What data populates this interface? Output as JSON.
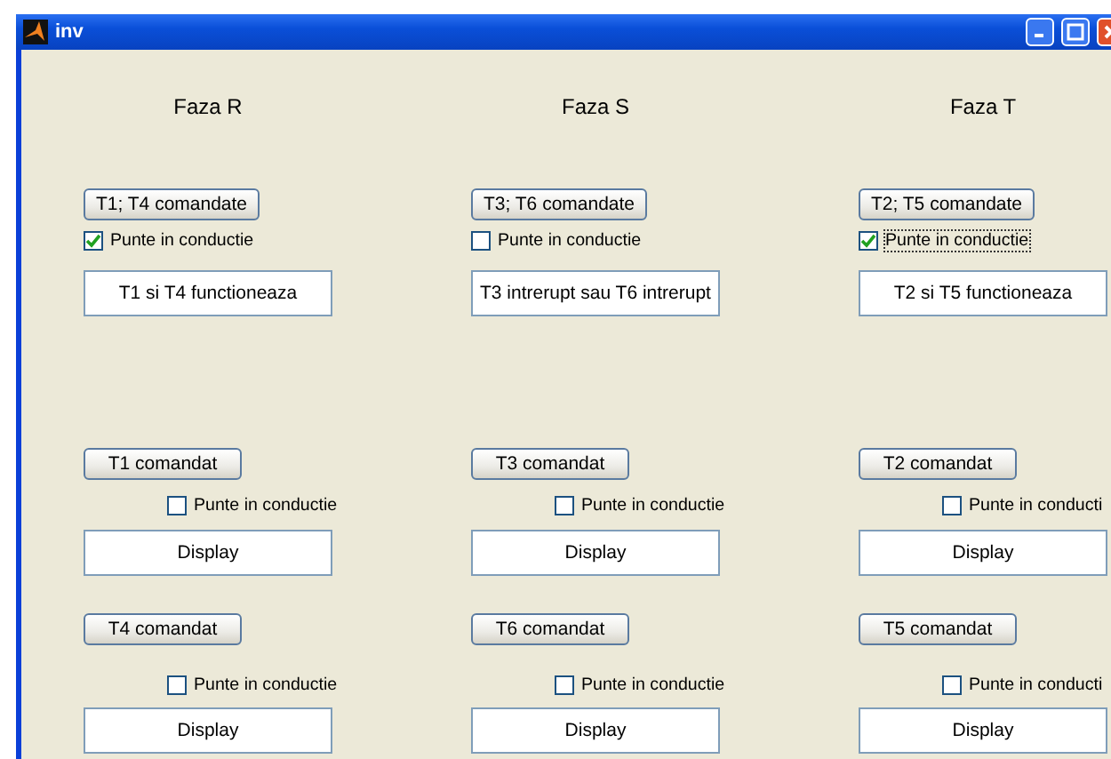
{
  "window": {
    "title": "inv"
  },
  "columns": [
    {
      "heading": "Faza R",
      "pair_button": "T1; T4 comandate",
      "pair_check": {
        "label": "Punte in conductie",
        "checked": true,
        "focused": false
      },
      "status": "T1 si T4 functioneaza",
      "rows": [
        {
          "button": "T1 comandat",
          "check": {
            "label": "Punte in conductie",
            "checked": false
          },
          "display": "Display"
        },
        {
          "button": "T4 comandat",
          "check": {
            "label": "Punte in conductie",
            "checked": false
          },
          "display": "Display"
        }
      ]
    },
    {
      "heading": "Faza S",
      "pair_button": "T3; T6 comandate",
      "pair_check": {
        "label": "Punte in conductie",
        "checked": false,
        "focused": false
      },
      "status": "T3 intrerupt sau T6 intrerupt",
      "rows": [
        {
          "button": "T3 comandat",
          "check": {
            "label": "Punte in conductie",
            "checked": false
          },
          "display": "Display"
        },
        {
          "button": "T6 comandat",
          "check": {
            "label": "Punte in conductie",
            "checked": false
          },
          "display": "Display"
        }
      ]
    },
    {
      "heading": "Faza T",
      "pair_button": "T2; T5 comandate",
      "pair_check": {
        "label": "Punte in conductie",
        "checked": true,
        "focused": true
      },
      "status": "T2 si T5 functioneaza",
      "rows": [
        {
          "button": "T2 comandat",
          "check": {
            "label": "Punte in conducti",
            "checked": false
          },
          "display": "Display"
        },
        {
          "button": "T5 comandat",
          "check": {
            "label": "Punte in conducti",
            "checked": false
          },
          "display": "Display"
        }
      ]
    }
  ]
}
